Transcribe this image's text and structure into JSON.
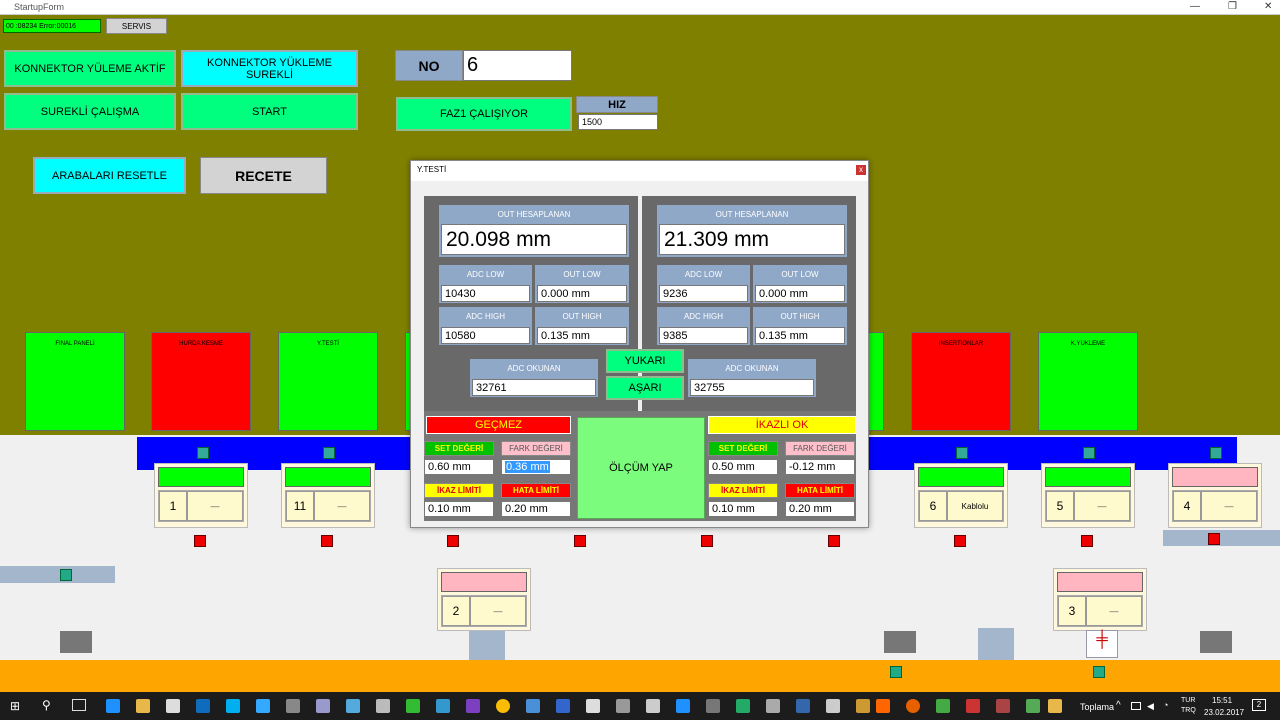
{
  "window": {
    "title": "StartupForm"
  },
  "status": {
    "text": "00 :08234 Error:00016",
    "servis": "SERVIS"
  },
  "buttons": {
    "konnektor_aktif": "KONNEKTOR YÜLEME AKTİF",
    "konnektor_surekli": "KONNEKTOR YÜKLEME SUREKLİ",
    "surekli": "SUREKLİ ÇALIŞMA",
    "start": "START",
    "reset": "ARABALARI RESETLE",
    "recete": "RECETE",
    "faz1": "FAZ1 ÇALIŞIYOR"
  },
  "no": {
    "label": "NO",
    "value": "6"
  },
  "hiz": {
    "label": "HIZ",
    "value": "1500"
  },
  "stations": [
    "FINAL PANELİ",
    "HURDA KESME",
    "Y.TESTİ",
    "INSERTIONLAR",
    "K.YUKLEME"
  ],
  "tiles": [
    {
      "num": "1",
      "text": "—"
    },
    {
      "num": "11",
      "text": "—"
    },
    {
      "num": "6",
      "text": "Kablolu"
    },
    {
      "num": "5",
      "text": "—"
    },
    {
      "num": "4",
      "text": "—"
    },
    {
      "num": "2",
      "text": "—"
    },
    {
      "num": "3",
      "text": "—"
    }
  ],
  "dialog": {
    "title": "Y.TESTİ",
    "close": "x",
    "left": {
      "out_label": "OUT HESAPLANAN",
      "out": "20.098 mm",
      "adc_low_l": "ADC LOW",
      "adc_low": "10430",
      "out_low_l": "OUT LOW",
      "out_low": "0.000 mm",
      "adc_high_l": "ADC HIGH",
      "adc_high": "10580",
      "out_high_l": "OUT HIGH",
      "out_high": "0.135 mm",
      "adc_ok_l": "ADC OKUNAN",
      "adc_ok": "32761"
    },
    "right": {
      "out_label": "OUT HESAPLANAN",
      "out": "21.309 mm",
      "adc_low_l": "ADC LOW",
      "adc_low": "9236",
      "out_low_l": "OUT LOW",
      "out_low": "0.000 mm",
      "adc_high_l": "ADC HIGH",
      "adc_high": "9385",
      "out_high_l": "OUT HIGH",
      "out_high": "0.135 mm",
      "adc_ok_l": "ADC OKUNAN",
      "adc_ok": "32755"
    },
    "yukari": "YUKARI",
    "asari": "AŞARI",
    "gecmez": "GEÇMEZ",
    "ikazli": "İKAZLI OK",
    "olcum": "ÖLÇÜM YAP",
    "l_set_l": "SET DEĞERİ",
    "l_set": "0.60 mm",
    "l_fark_l": "FARK DEĞERİ",
    "l_fark": "0.36 mm",
    "l_ikaz_l": "İKAZ LİMİTİ",
    "l_ikaz": "0.10 mm",
    "l_hata_l": "HATA LİMİTİ",
    "l_hata": "0.20 mm",
    "r_set_l": "SET DEĞERİ",
    "r_set": "0.50 mm",
    "r_fark_l": "FARK DEĞERİ",
    "r_fark": "-0.12 mm",
    "r_ikaz_l": "İKAZ LİMİTİ",
    "r_ikaz": "0.10 mm",
    "r_hata_l": "HATA LİMİTİ",
    "r_hata": "0.20 mm"
  },
  "taskbar": {
    "toplama": "Toplama",
    "lang": "TUR TRQ",
    "time": "15:51",
    "date": "23.02.2017",
    "notif": "2"
  }
}
